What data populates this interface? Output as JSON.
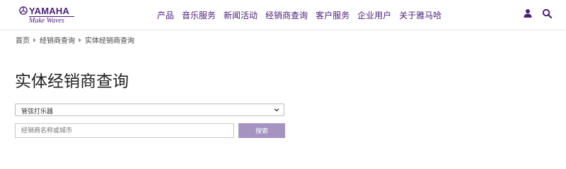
{
  "brand": {
    "name": "YAMAHA",
    "tagline": "Make Waves"
  },
  "nav": {
    "items": [
      "产品",
      "音乐服务",
      "新闻活动",
      "经销商查询",
      "客户服务",
      "企业用户",
      "关于雅马哈"
    ]
  },
  "icons": {
    "account": "user-icon",
    "search": "search-icon"
  },
  "breadcrumb": {
    "items": [
      "首页",
      "经销商查询",
      "实体经销商查询"
    ]
  },
  "page": {
    "title": "实体经销商查询"
  },
  "form": {
    "category_select_value": "管弦打乐器",
    "search_placeholder": "经销商名称或城市",
    "search_button_label": "搜索"
  },
  "colors": {
    "brand": "#4b1e78",
    "button": "#a593c1"
  }
}
